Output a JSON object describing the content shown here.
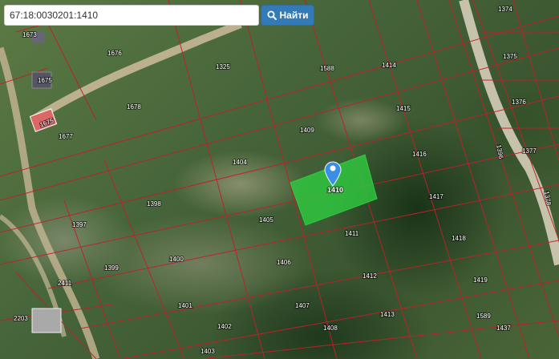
{
  "search": {
    "value": "67:18:0030201:1410",
    "button_label": "Найти",
    "button_icon": "search-icon"
  },
  "map": {
    "selected_parcel": "1410",
    "selected_color": "#2ecc40",
    "boundary_color": "#c0202a",
    "marker_color": "#3a8ee6",
    "parcels": [
      "1673",
      "1676",
      "1675",
      "1325",
      "1588",
      "1414",
      "1374",
      "1375",
      "1678",
      "1677",
      "1409",
      "1415",
      "1376",
      "1377",
      "1404",
      "1416",
      "1396",
      "1378",
      "1398",
      "1405",
      "1417",
      "1397",
      "1411",
      "1418",
      "1400",
      "1399",
      "1406",
      "1412",
      "1419",
      "2411",
      "1401",
      "1407",
      "1413",
      "1589",
      "1402",
      "1408",
      "1437",
      "2203",
      "1403"
    ],
    "building_labels": [
      "1675"
    ]
  }
}
